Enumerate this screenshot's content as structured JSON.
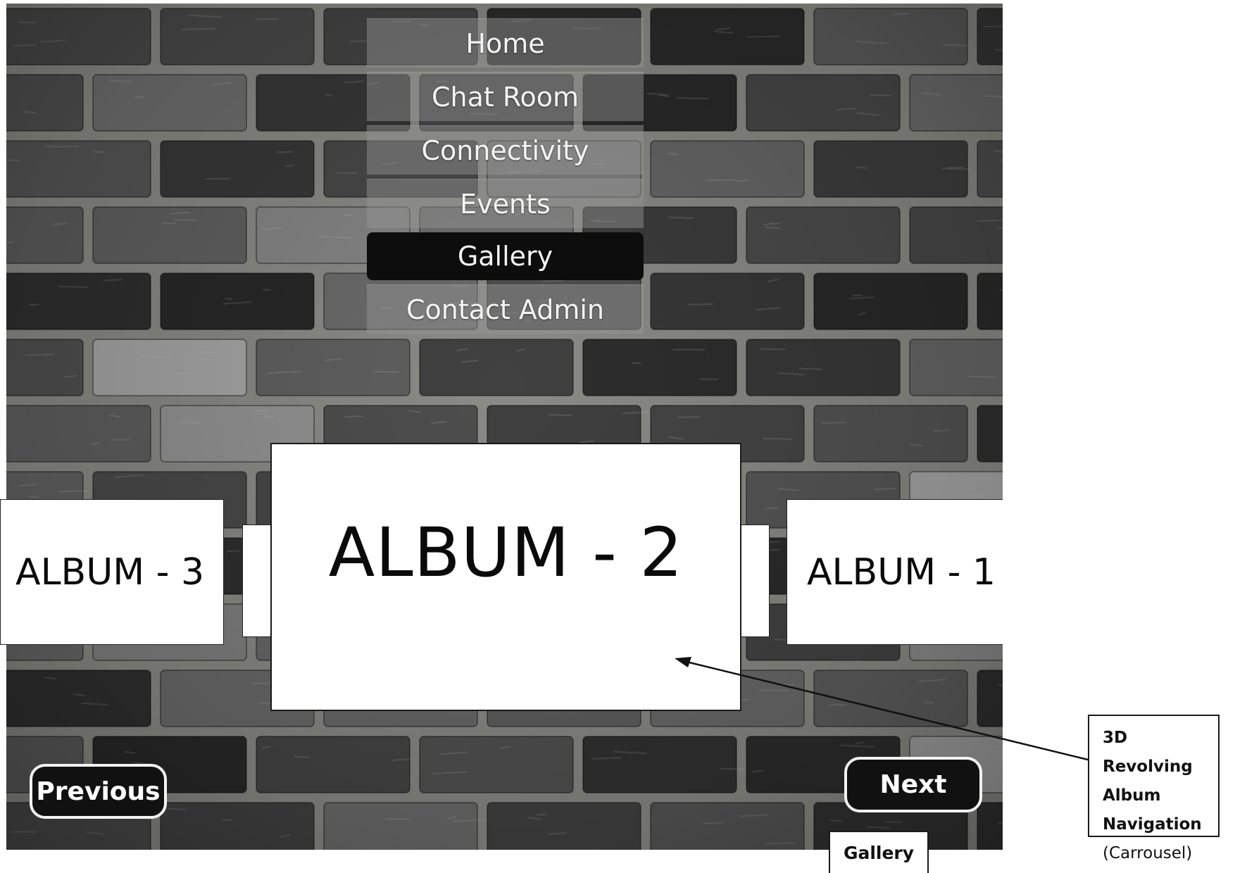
{
  "nav": {
    "items": [
      {
        "label": "Home",
        "active": false
      },
      {
        "label": "Chat Room",
        "active": false
      },
      {
        "label": "Connectivity",
        "active": false
      },
      {
        "label": "Events",
        "active": false
      },
      {
        "label": "Gallery",
        "active": true
      },
      {
        "label": "Contact Admin",
        "active": false
      }
    ]
  },
  "carousel": {
    "left_album": "ALBUM - 3",
    "center_album": "ALBUM - 2",
    "right_album": "ALBUM - 1"
  },
  "buttons": {
    "previous": "Previous",
    "next": "Next"
  },
  "annotation": {
    "line1": "3D Revolving",
    "line2": "Album",
    "line3": "Navigation",
    "line4": "(Carrousel)"
  },
  "page_tag": "Gallery",
  "colors": {
    "nav_active_bg": "#0d0d0d",
    "button_bg": "#111111",
    "button_border": "#f2f2f2",
    "album_bg": "#ffffff"
  }
}
